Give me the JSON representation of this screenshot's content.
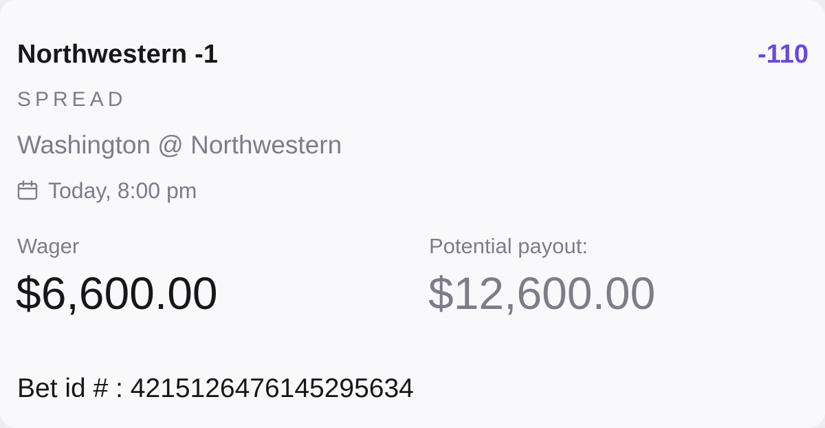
{
  "bet": {
    "selection": "Northwestern -1",
    "odds": "-110",
    "market": "SPREAD",
    "matchup": "Washington @ Northwestern",
    "time": "Today, 8:00 pm",
    "time_icon": "calendar-icon",
    "wager_label": "Wager",
    "wager_value": "$6,600.00",
    "payout_label": "Potential payout:",
    "payout_value": "$12,600.00",
    "bet_id_label": "Bet id # : ",
    "bet_id": "4215126476145295634"
  },
  "colors": {
    "card_background": "#f9f9fc",
    "primary_text": "#16161c",
    "secondary_text": "#7c7c8a",
    "odds_accent": "#6a48e0"
  }
}
